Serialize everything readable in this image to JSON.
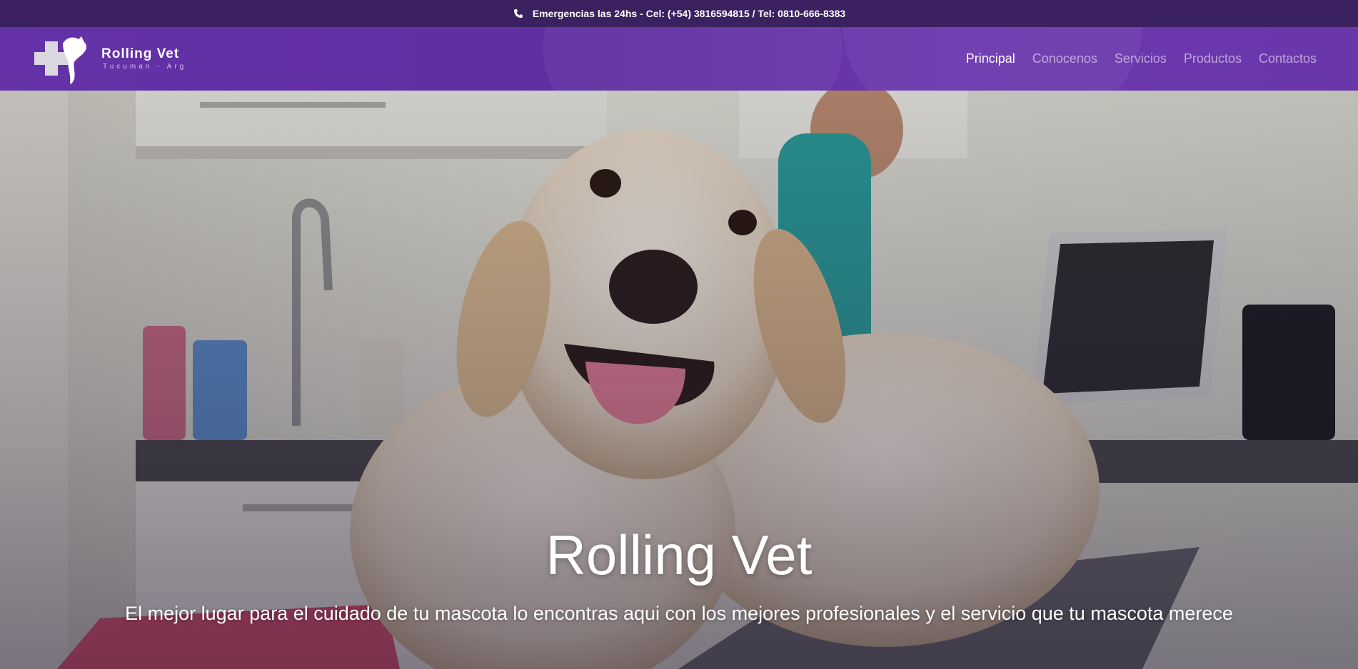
{
  "topbar": {
    "icon": "phone-icon",
    "text": "Emergencias las 24hs - Cel: (+54) 3816594815 / Tel: 0810-666-8383"
  },
  "brand": {
    "icon": "cross-dog-cat-logo-icon",
    "name": "Rolling Vet",
    "subtitle": "Tucuman - Arg"
  },
  "nav": {
    "items": [
      {
        "label": "Principal",
        "active": true
      },
      {
        "label": "Conocenos",
        "active": false
      },
      {
        "label": "Servicios",
        "active": false
      },
      {
        "label": "Productos",
        "active": false
      },
      {
        "label": "Contactos",
        "active": false
      }
    ]
  },
  "hero": {
    "title": "Rolling Vet",
    "subtitle": "El mejor lugar para el cuidado de tu mascota lo encontras aqui con los mejores profesionales y el servicio que tu mascota merece"
  },
  "colors": {
    "topbar": "#3b2160",
    "navbar": "#6532a8",
    "text": "#ffffff"
  }
}
